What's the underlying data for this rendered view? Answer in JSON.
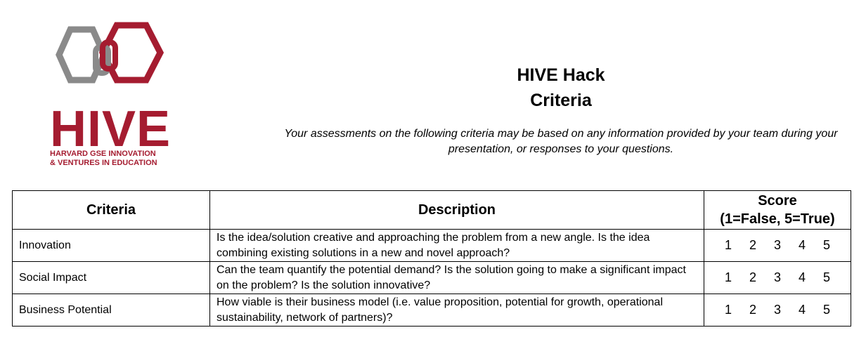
{
  "logo": {
    "word": "HIVE",
    "subtitle_line1": "HARVARD GSE INNOVATION",
    "subtitle_line2": "& VENTURES IN EDUCATION",
    "colors": {
      "crimson": "#a51c30",
      "gray": "#8a8a8a"
    }
  },
  "header": {
    "title_line1": "HIVE Hack",
    "title_line2": "Criteria"
  },
  "note": {
    "text": "Your assessments on the following criteria may be based on any information provided by your team during your presentation, or responses to your questions."
  },
  "table": {
    "headers": {
      "criteria": "Criteria",
      "description": "Description",
      "score_line1": "Score",
      "score_line2": "(1=False, 5=True)"
    },
    "rows": [
      {
        "criteria": "Innovation",
        "description": "Is the idea/solution creative and approaching the problem from a new angle. Is the idea combining existing solutions in a new and novel approach?",
        "scores": [
          "1",
          "2",
          "3",
          "4",
          "5"
        ]
      },
      {
        "criteria": "Social Impact",
        "description": "Can the team quantify the potential demand? Is the solution going to make a significant impact on the problem? Is the solution innovative?",
        "scores": [
          "1",
          "2",
          "3",
          "4",
          "5"
        ]
      },
      {
        "criteria": "Business Potential",
        "description": "How viable is their business model (i.e. value proposition, potential for growth, operational sustainability, network of partners)?",
        "scores": [
          "1",
          "2",
          "3",
          "4",
          "5"
        ]
      }
    ]
  }
}
